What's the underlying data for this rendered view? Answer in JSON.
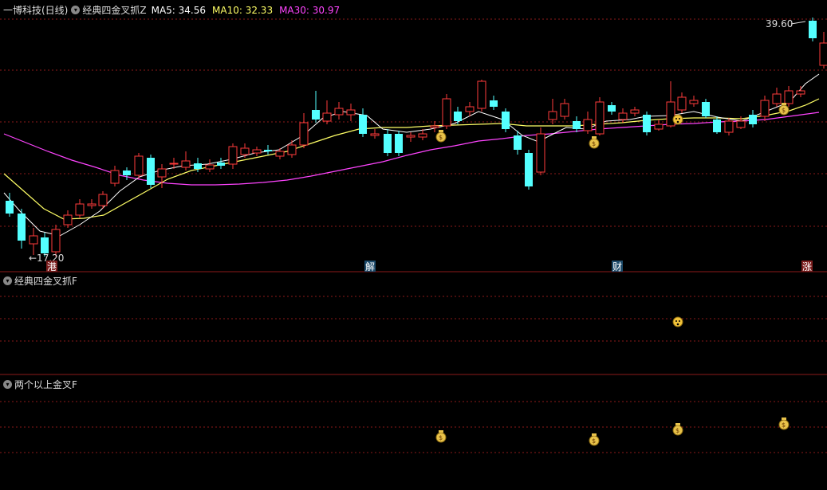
{
  "main": {
    "stock_name": "一博科技(日线)",
    "indicator_name": "经典四金叉抓Z",
    "ma5": {
      "label": "MA5: 34.56",
      "color": "#ffffff"
    },
    "ma10": {
      "label": "MA10: 32.33",
      "color": "#ffff66"
    },
    "ma30": {
      "label": "MA30: 30.97",
      "color": "#ff44ff"
    },
    "high_label": "39.60",
    "low_label": "17.20",
    "markers": [
      {
        "text": "港",
        "color": "#cc3333"
      },
      {
        "text": "解",
        "color": "#3399cc"
      },
      {
        "text": "财",
        "color": "#3399cc"
      },
      {
        "text": "涨",
        "color": "#cc3333"
      }
    ],
    "icons": [
      "money-bag-icon",
      "money-bag-icon",
      "smiley-icon",
      "money-bag-icon"
    ]
  },
  "panel2": {
    "title": "经典四金叉抓F"
  },
  "panel3": {
    "title": "两个以上金叉F"
  },
  "colors": {
    "up": "#ff3b3b",
    "down": "#54ffff",
    "grid": "#8b1a1a",
    "bg": "#000000"
  }
}
